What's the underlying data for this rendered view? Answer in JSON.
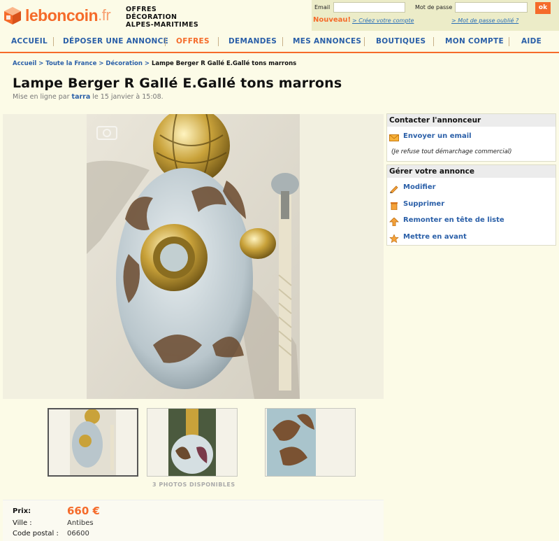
{
  "site": {
    "logo_name": "leboncoin",
    "logo_suffix": ".fr",
    "header_lines": [
      "OFFRES",
      "DÉCORATION",
      "ALPES-MARITIMES"
    ]
  },
  "login": {
    "email_label": "Email",
    "password_label": "Mot de passe",
    "ok_label": "ok",
    "nouveau": "Nouveau!",
    "create_account": "> Créez votre compte",
    "forgot_password": "> Mot de passe oublié ?"
  },
  "nav": {
    "items": [
      "ACCUEIL",
      "DÉPOSER UNE ANNONCE",
      "OFFRES",
      "DEMANDES",
      "MES ANNONCES",
      "BOUTIQUES",
      "MON COMPTE",
      "AIDE"
    ],
    "active": "OFFRES"
  },
  "breadcrumb": {
    "items": [
      "Accueil",
      "Toute la France",
      "Décoration"
    ],
    "sep": " > ",
    "current": "Lampe Berger R Gallé E.Gallé tons marrons"
  },
  "ad": {
    "title": "Lampe Berger R Gallé E.Gallé tons marrons",
    "posted_prefix": "Mise en ligne par",
    "user": "tarra",
    "posted_suffix": "le 15 janvier à 15:08.",
    "photos_count": "3 PHOTOS DISPONIBLES",
    "price_label": "Prix:",
    "price": "660 €",
    "city_label": "Ville :",
    "city": "Antibes",
    "postal_label": "Code postal :",
    "postal": "06600"
  },
  "contact_panel": {
    "title": "Contacter l'annonceur",
    "email_action": "Envoyer un email",
    "note": "(Je refuse tout démarchage commercial)"
  },
  "manage_panel": {
    "title": "Gérer votre annonce",
    "actions": [
      "Modifier",
      "Supprimer",
      "Remonter en tête de liste",
      "Mettre en avant"
    ]
  },
  "colors": {
    "brand_orange": "#f56b2a",
    "link_blue": "#2a5fa8",
    "page_bg": "#fcfbe7"
  },
  "icons": [
    "box-logo-icon",
    "envelope-icon",
    "pencil-icon",
    "trash-icon",
    "arrow-up-icon",
    "star-icon"
  ]
}
